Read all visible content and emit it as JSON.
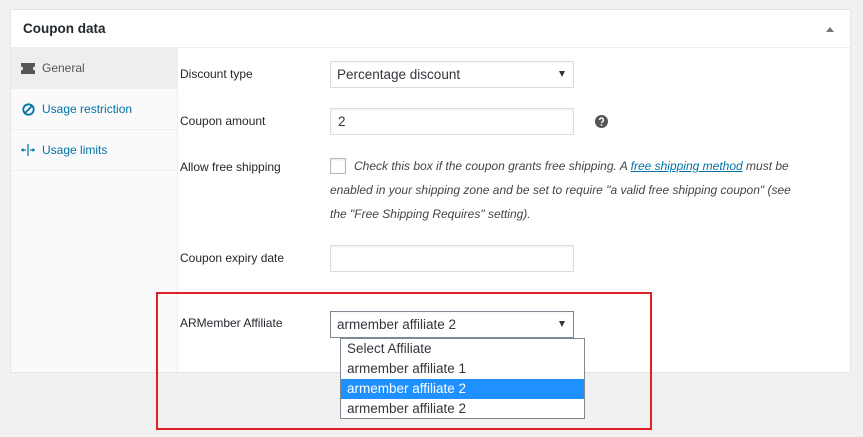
{
  "panel": {
    "title": "Coupon data"
  },
  "tabs": [
    {
      "label": "General",
      "icon": "ticket-icon",
      "active": true
    },
    {
      "label": "Usage restriction",
      "icon": "no-entry-icon",
      "active": false
    },
    {
      "label": "Usage limits",
      "icon": "arrows-spread-icon",
      "active": false
    }
  ],
  "fields": {
    "discount_type": {
      "label": "Discount type",
      "value": "Percentage discount"
    },
    "coupon_amount": {
      "label": "Coupon amount",
      "value": "2",
      "help_icon": "question-circle-icon"
    },
    "free_shipping": {
      "label": "Allow free shipping",
      "checked": false,
      "description_pre": "Check this box if the coupon grants free shipping. A ",
      "link_text": "free shipping method",
      "description_line1_post": " must be",
      "description_line2": "enabled in your shipping zone and be set to require \"a valid free shipping coupon\" (see",
      "description_line3": "the \"Free Shipping Requires\" setting)."
    },
    "expiry_date": {
      "label": "Coupon expiry date",
      "value": ""
    },
    "armember_affiliate": {
      "label": "ARMember Affiliate",
      "value": "armember affiliate 2",
      "options": [
        {
          "label": "Select Affiliate",
          "selected": false
        },
        {
          "label": "armember affiliate 1",
          "selected": false
        },
        {
          "label": "armember affiliate 2",
          "selected": true
        },
        {
          "label": "armember affiliate 2",
          "selected": false
        }
      ]
    }
  },
  "colors": {
    "link": "#0073aa",
    "highlight_border": "#e21f26",
    "selected_option": "#1e90ff"
  }
}
